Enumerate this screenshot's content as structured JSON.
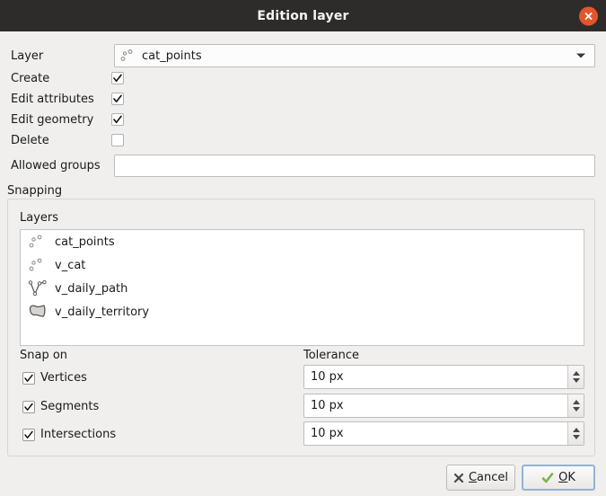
{
  "window": {
    "title": "Edition layer",
    "close_icon": "close-circle-icon"
  },
  "form": {
    "layer_label": "Layer",
    "layer_value": "cat_points",
    "layer_icon": "point-layer-icon",
    "dropdown_icon": "chevron-down-icon",
    "permissions": [
      {
        "label": "Create",
        "checked": true
      },
      {
        "label": "Edit attributes",
        "checked": true
      },
      {
        "label": "Edit geometry",
        "checked": true
      },
      {
        "label": "Delete",
        "checked": false
      }
    ],
    "allowed_groups_label": "Allowed groups",
    "allowed_groups_value": "",
    "allowed_groups_placeholder": ""
  },
  "snapping": {
    "title": "Snapping",
    "layers_label": "Layers",
    "layers": [
      {
        "name": "cat_points",
        "icon": "point-layer-icon"
      },
      {
        "name": "v_cat",
        "icon": "point-layer-icon"
      },
      {
        "name": "v_daily_path",
        "icon": "line-layer-icon"
      },
      {
        "name": "v_daily_territory",
        "icon": "polygon-layer-icon"
      }
    ],
    "snap_on_label": "Snap on",
    "tolerance_label": "Tolerance",
    "rows": [
      {
        "label": "Vertices",
        "checked": true,
        "tolerance": "10 px"
      },
      {
        "label": "Segments",
        "checked": true,
        "tolerance": "10 px"
      },
      {
        "label": "Intersections",
        "checked": true,
        "tolerance": "10 px"
      }
    ]
  },
  "footer": {
    "cancel_label": "Cancel",
    "cancel_mnemonic": "C",
    "cancel_rest": "ancel",
    "ok_label": "OK",
    "ok_mnemonic": "O",
    "ok_rest": "K",
    "cancel_icon": "x-mark-icon",
    "ok_icon": "check-mark-icon"
  },
  "colors": {
    "titlebar": "#2e2c2b",
    "background": "#f0efee",
    "close_button": "#e4552b",
    "focus_border": "#8fb4d9",
    "ok_check": "#7cb342"
  }
}
